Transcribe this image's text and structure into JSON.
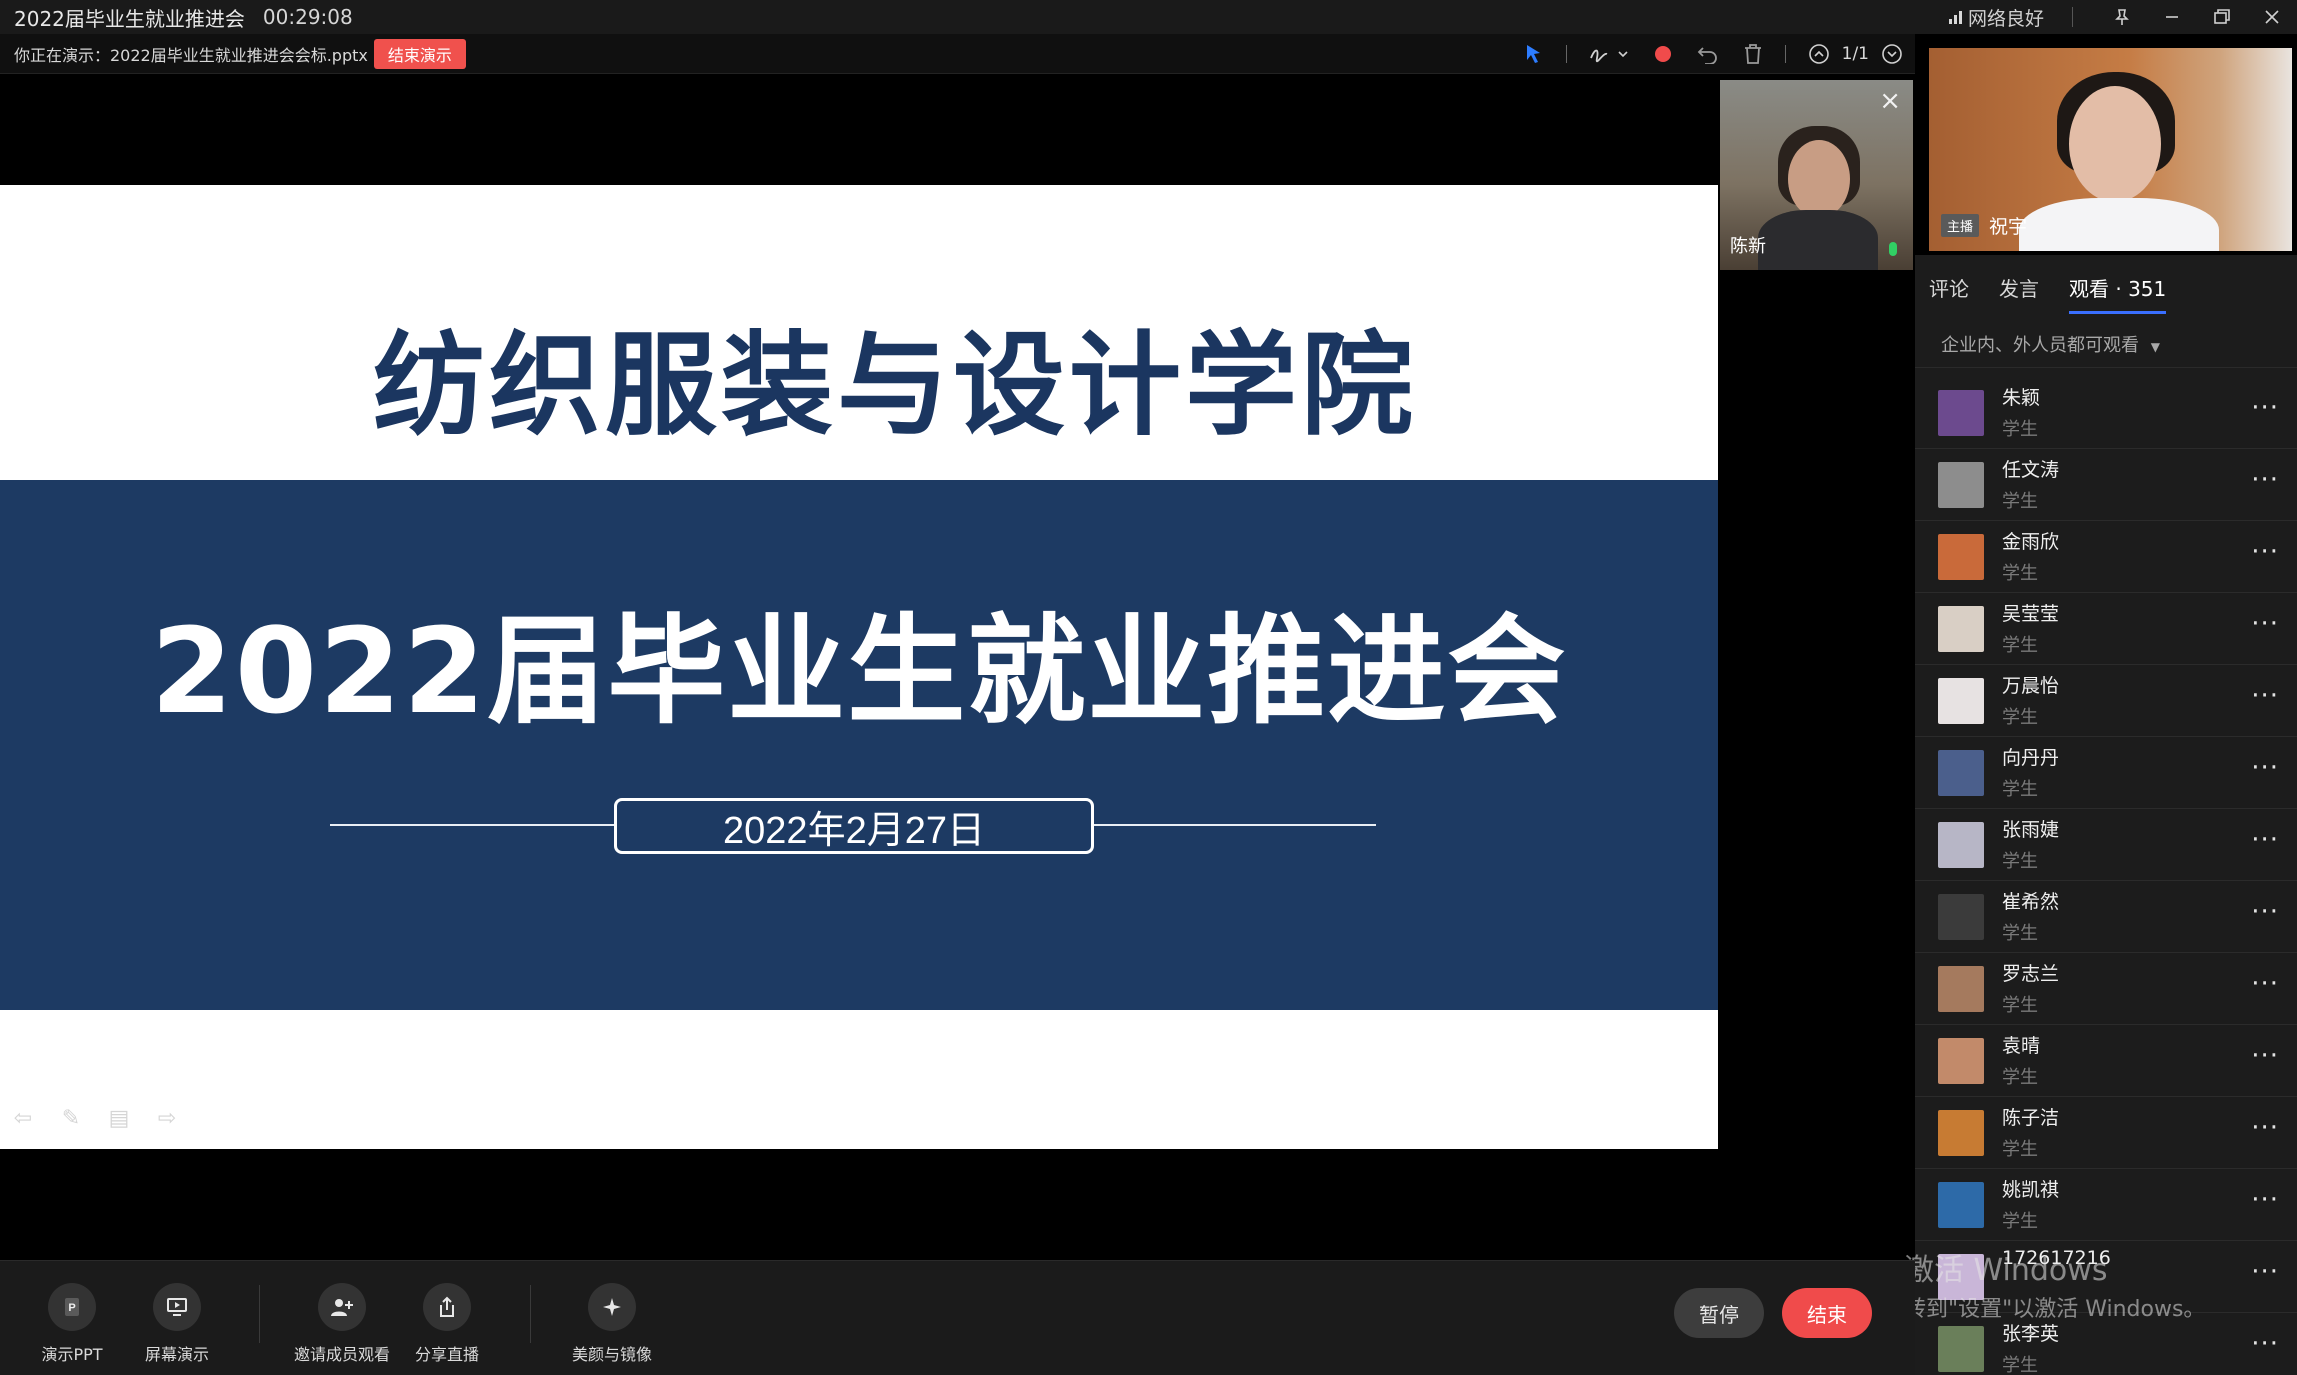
{
  "window": {
    "title": "2022届毕业生就业推进会",
    "timer": "00:29:08",
    "network": "网络良好",
    "controls": [
      "pin-icon",
      "minimize-icon",
      "restore-icon",
      "close-icon"
    ]
  },
  "presentation_bar": {
    "presenting_text": "你正在演示：2022届毕业生就业推进会会标.pptx",
    "end_presentation": "结束演示",
    "page_indicator": "1/1",
    "tools": [
      "pointer-icon",
      "pen-icon",
      "record-icon",
      "undo-icon",
      "delete-icon",
      "prev-page-icon",
      "next-page-icon"
    ]
  },
  "slide": {
    "school_name": "纺织服装与设计学院",
    "event_title": "2022届毕业生就业推进会",
    "date": "2022年2月27日",
    "colors": {
      "navy": "#1d3a63",
      "title_navy": "#1b3660"
    }
  },
  "video_tile": {
    "name": "陈新"
  },
  "host_video": {
    "role_tag": "主播",
    "name": "祝宇"
  },
  "panel": {
    "tabs": {
      "comment": "评论",
      "speak": "发言",
      "watch": "观看 · 351"
    },
    "visibility": "企业内、外人员都可观看",
    "viewers": [
      {
        "name": "朱颖",
        "role": "学生",
        "color": "#6c4a8e"
      },
      {
        "name": "任文涛",
        "role": "学生",
        "color": "#8d8d8d"
      },
      {
        "name": "金雨欣",
        "role": "学生",
        "color": "#c96a3a"
      },
      {
        "name": "吴莹莹",
        "role": "学生",
        "color": "#d9cfc5"
      },
      {
        "name": "万晨怡",
        "role": "学生",
        "color": "#e7e2e2"
      },
      {
        "name": "向丹丹",
        "role": "学生",
        "color": "#4b5f8c"
      },
      {
        "name": "张雨婕",
        "role": "学生",
        "color": "#b7b6c6"
      },
      {
        "name": "崔希然",
        "role": "学生",
        "color": "#3b3b3b"
      },
      {
        "name": "罗志兰",
        "role": "学生",
        "color": "#a57a5e"
      },
      {
        "name": "袁晴",
        "role": "学生",
        "color": "#c28a6a"
      },
      {
        "name": "陈子洁",
        "role": "学生",
        "color": "#c77b33"
      },
      {
        "name": "姚凯祺",
        "role": "学生",
        "color": "#2d6aa8"
      },
      {
        "name": "172617216",
        "role": "",
        "color": "#c9b6d8"
      },
      {
        "name": "张李英",
        "role": "学生",
        "color": "#6a7f5a"
      }
    ]
  },
  "watermark": {
    "line1": "激活 Windows",
    "line2": "转到\"设置\"以激活 Windows。"
  },
  "bottom_bar": {
    "buttons": {
      "ppt": "演示PPT",
      "screen": "屏幕演示",
      "invite": "邀请成员观看",
      "share": "分享直播",
      "beauty": "美颜与镜像"
    },
    "pause": "暂停",
    "end": "结束"
  }
}
